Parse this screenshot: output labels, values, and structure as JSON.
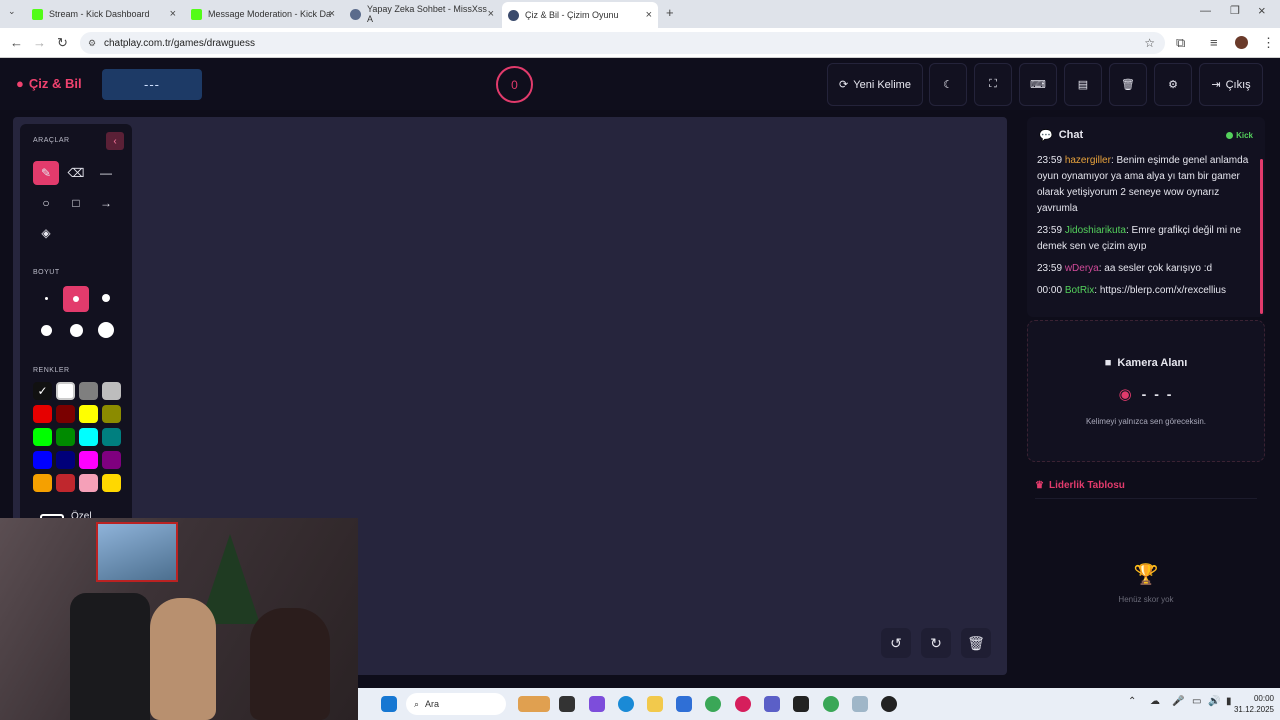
{
  "browser": {
    "tabs": [
      {
        "title": "Stream - Kick Dashboard",
        "icon": "kick-icon",
        "active": false
      },
      {
        "title": "Message Moderation - Kick Da",
        "icon": "kick-icon",
        "active": false
      },
      {
        "title": "Yapay Zeka Sohbet - MissXss A",
        "icon": "globe-icon",
        "active": false
      },
      {
        "title": "Çiz & Bil - Çizim Oyunu",
        "icon": "gamepad-icon",
        "active": true
      }
    ],
    "url": "chatplay.com.tr/games/drawguess"
  },
  "header": {
    "logo": "Çiz & Bil",
    "word": "---",
    "timer": "0",
    "new_word": "Yeni Kelime",
    "logout": "Çıkış"
  },
  "tools": {
    "section_tools": "ARAÇLAR",
    "section_size": "BOYUT",
    "section_colors": "RENKLER",
    "custom_label": "Özel",
    "colors": [
      "#111111",
      "#ffffff",
      "#7f7f7f",
      "#bdbdbd",
      "#e60000",
      "#7a0000",
      "#ffff00",
      "#8b8b00",
      "#00ff00",
      "#008a00",
      "#00ffff",
      "#007f7f",
      "#0000ff",
      "#00007a",
      "#ff00ff",
      "#7f007f",
      "#f5a000",
      "#c0272d",
      "#f5a0b8",
      "#ffd800"
    ]
  },
  "chat": {
    "title": "Chat",
    "platform": "Kick",
    "messages": [
      {
        "time": "23:59",
        "user": "hazergiller",
        "color": "#e8a33c",
        "text": ": Benim eşimde genel anlamda oyun oynamıyor ya ama alya yı tam bir gamer olarak yetişiyorum 2 seneye wow oynarız yavrumla"
      },
      {
        "time": "23:59",
        "user": "Jidoshiarikuta",
        "color": "#54d15c",
        "text": ": Emre grafikçi değil mi ne demek sen ve çizim ayıp"
      },
      {
        "time": "23:59",
        "user": "wDerya",
        "color": "#d24b9a",
        "text": ": aa sesler çok karışıyo :d"
      },
      {
        "time": "00:00",
        "user": "BotRix",
        "color": "#54d15c",
        "text": ": https://blerp.com/x/rexcellius"
      }
    ]
  },
  "camera": {
    "title": "Kamera Alanı",
    "word": "- - -",
    "note": "Kelimeyi yalnızca sen göreceksin."
  },
  "leaderboard": {
    "title": "Liderlik Tablosu",
    "empty": "Henüz skor yok"
  },
  "taskbar": {
    "search": "Ara",
    "time": "00:00",
    "date": "31.12.2025"
  }
}
